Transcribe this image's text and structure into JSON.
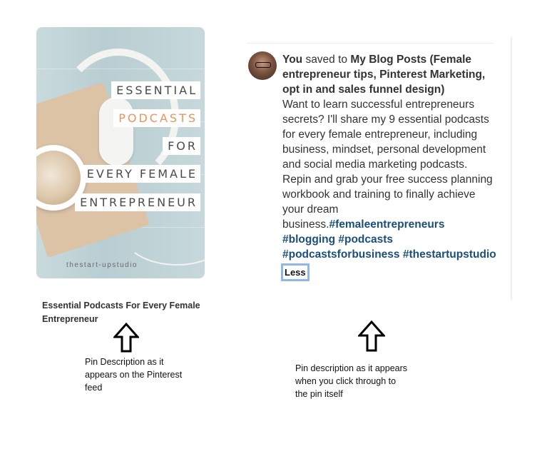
{
  "pin_image": {
    "title_lines": [
      "ESSENTIAL",
      "PODCASTS",
      "FOR",
      "EVERY FEMALE",
      "ENTREPRENEUR"
    ],
    "brand": "thestart-upstudio",
    "accent_color": "#e8955b"
  },
  "feed": {
    "caption": "Essential Podcasts For Every Female Entrepreneur",
    "annotation": "Pin Description as it appears on the Pinterest feed"
  },
  "closeup": {
    "saver": "You",
    "saved_to_text": "saved to",
    "board": "My Blog Posts (Female entrepreneur tips, Pinterest Marketing, opt in and sales funnel design)",
    "description": "Want to learn successful entrepreneurs secrets? I'll share my 9 essential podcasts for every female entrepreneur, including business, mindset, personal development and social media marketing podcasts. Repin and grab your free success planning workbook and training to finally achieve your dream business.",
    "hashtags": [
      "#femaleentrepreneurs",
      "#blogging",
      "#podcasts",
      "#podcastsforbusiness",
      "#thestartupstudio"
    ],
    "less_label": "Less",
    "hashtag_color": "#1b4f7a",
    "annotation": "Pin description as it appears when you click through to the pin itself"
  },
  "icons": {
    "arrow_left": "up-arrow-icon",
    "arrow_right": "up-arrow-icon"
  }
}
